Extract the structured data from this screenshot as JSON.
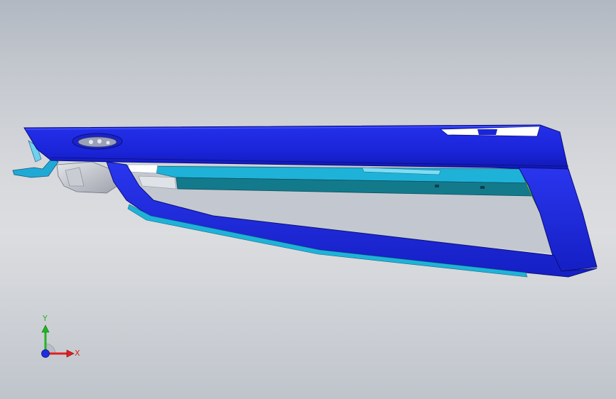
{
  "viewport": {
    "model_name": "",
    "background_top": "#b1b8c2",
    "background_mid": "#dcdde0",
    "background_bottom": "#bfc4cb"
  },
  "model": {
    "icon": "door-trim-panel-model",
    "primary_color": "#1a24d8",
    "accent_colors": {
      "cyan": "#1fb2d8",
      "light_cyan": "#7fdcf2",
      "teal": "#137a8c",
      "green": "#7ee35a",
      "grey": "#b8bcc6",
      "white": "#ffffff"
    }
  },
  "triad": {
    "icon": "coordinate-triad-icon",
    "x_label": "X",
    "y_label": "Y",
    "x_color": "#e02020",
    "y_color": "#22b422",
    "z_color": "#1d2ee0"
  }
}
